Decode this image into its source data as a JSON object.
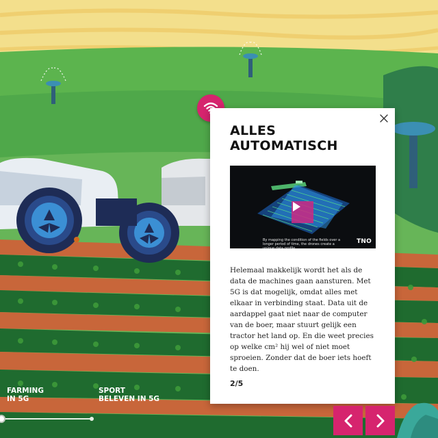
{
  "panel": {
    "title_line1": "ALLES",
    "title_line2": "AUTOMATISCH",
    "video": {
      "caption": "By mapping the condition of the fields over a longer period of time, the drones create a unique data profile.",
      "logo": "TNO"
    },
    "body": "Helemaal makkelijk wordt het als de data de machines gaan aansturen. Met 5G is dat mogelijk, omdat alles met elkaar in verbinding staat. Data uit de aardappel gaat niet naar de computer van de boer, maar stuurt gelijk een tractor het land op. En die weet precies op welke cm² hij wel of niet moet sproeien. Zonder dat de boer iets hoeft te doen.",
    "pager": "2/5"
  },
  "chapters": [
    {
      "line1": "FARMING",
      "line2": "IN 5G"
    },
    {
      "line1": "SPORT",
      "line2": "BELEVEN IN 5G"
    }
  ],
  "timeline": {
    "progress": 0.0
  },
  "icons": {
    "badge": "wifi-icon",
    "close": "close-icon",
    "prev": "chevron-left-icon",
    "next": "chevron-right-icon",
    "play": "play-icon"
  },
  "colors": {
    "accent": "#d6246e",
    "sky": "#f3df8c",
    "field": "#4fa84a",
    "soil": "#c8663a"
  }
}
